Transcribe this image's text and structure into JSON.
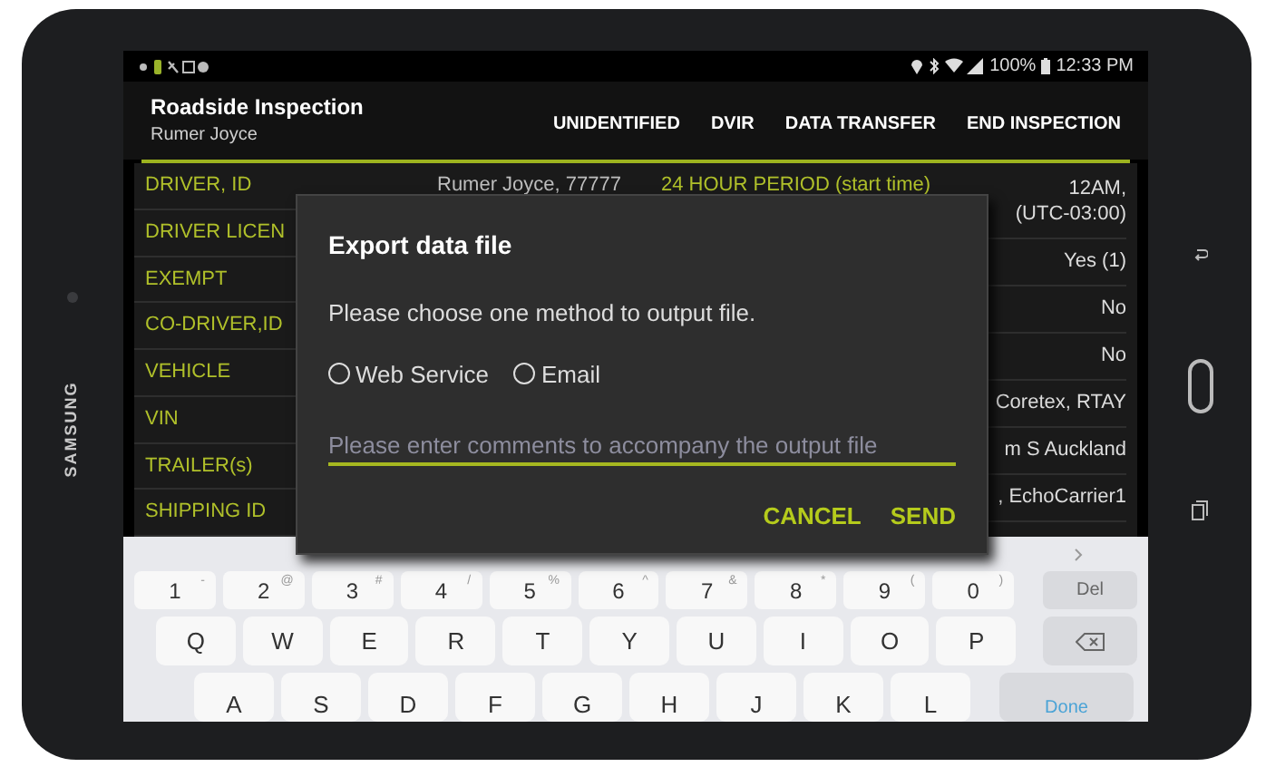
{
  "device": {
    "brand": "SAMSUNG"
  },
  "status_bar": {
    "battery": "100%",
    "time": "12:33 PM"
  },
  "app_bar": {
    "title": "Roadside Inspection",
    "subtitle": "Rumer Joyce",
    "actions": [
      "UNIDENTIFIED",
      "DVIR",
      "DATA TRANSFER",
      "END INSPECTION"
    ]
  },
  "table": {
    "labels": [
      "DRIVER, ID",
      "DRIVER LICEN",
      "EXEMPT",
      "CO-DRIVER,ID",
      "VEHICLE",
      "VIN",
      "TRAILER(s)",
      "SHIPPING ID"
    ],
    "first_row": {
      "driver": "Rumer Joyce, 77777",
      "period": "24 HOUR PERIOD (start time)"
    },
    "values": [
      "12AM, (UTC-03:00)",
      "Yes (1)",
      "No",
      "No",
      "Coretex, RTAY",
      "m S Auckland",
      ", EchoCarrier1"
    ]
  },
  "dialog": {
    "title": "Export data file",
    "message": "Please choose one method to output file.",
    "options": [
      {
        "label": "Web Service",
        "selected": false
      },
      {
        "label": "Email",
        "selected": false
      }
    ],
    "comment_placeholder": "Please enter comments to accompany the output file",
    "buttons": [
      "CANCEL",
      "SEND"
    ]
  },
  "keyboard": {
    "number_keys": [
      {
        "key": "1",
        "alt": "-"
      },
      {
        "key": "2",
        "alt": "@"
      },
      {
        "key": "3",
        "alt": "#"
      },
      {
        "key": "4",
        "alt": "/"
      },
      {
        "key": "5",
        "alt": "%"
      },
      {
        "key": "6",
        "alt": "^"
      },
      {
        "key": "7",
        "alt": "&"
      },
      {
        "key": "8",
        "alt": "*"
      },
      {
        "key": "9",
        "alt": "("
      },
      {
        "key": "0",
        "alt": ")"
      }
    ],
    "delete_key": "Del",
    "letter_row_1": [
      "Q",
      "W",
      "E",
      "R",
      "T",
      "Y",
      "U",
      "I",
      "O",
      "P"
    ],
    "letter_row_2": [
      "A",
      "S",
      "D",
      "F",
      "G",
      "H",
      "J",
      "K",
      "L"
    ],
    "done_key": "Done"
  }
}
